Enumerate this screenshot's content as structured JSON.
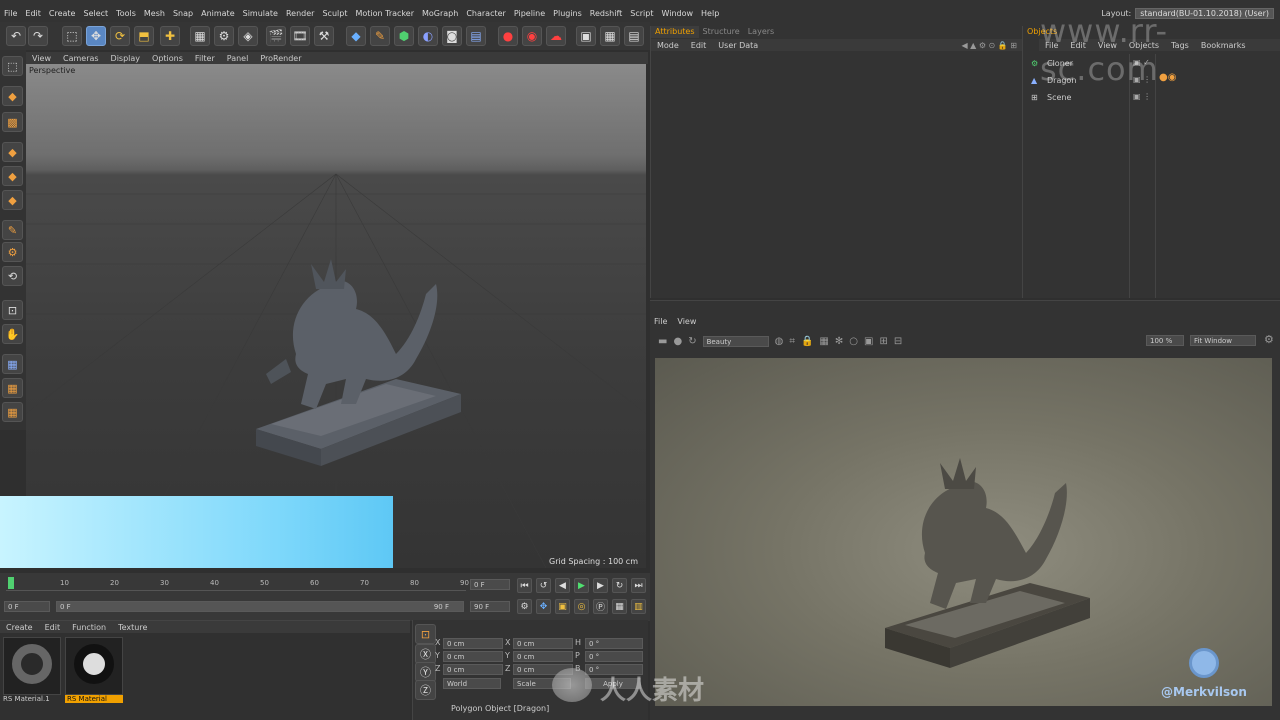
{
  "menu": [
    "File",
    "Edit",
    "Create",
    "Select",
    "Tools",
    "Mesh",
    "Snap",
    "Animate",
    "Simulate",
    "Render",
    "Sculpt",
    "Motion Tracker",
    "MoGraph",
    "Character",
    "Pipeline",
    "Plugins",
    "Redshift",
    "Script",
    "Window",
    "Help"
  ],
  "layout": {
    "label": "Layout:",
    "value": "standard(BU-01.10.2018) (User)"
  },
  "viewport": {
    "menu": [
      "View",
      "Cameras",
      "Display",
      "Options",
      "Filter",
      "Panel",
      "ProRender"
    ],
    "label": "Perspective",
    "grid_spacing": "Grid Spacing : 100 cm"
  },
  "timeline": {
    "ticks": [
      "0",
      "10",
      "20",
      "30",
      "40",
      "50",
      "60",
      "70",
      "80",
      "90"
    ],
    "current_frame": "0 F",
    "start": "0 F",
    "start2": "0 F",
    "end": "90 F",
    "end2": "90 F"
  },
  "materials": {
    "menu": [
      "Create",
      "Edit",
      "Function",
      "Texture"
    ],
    "items": [
      {
        "name": "RS Material.1",
        "selected": false
      },
      {
        "name": "RS Material",
        "selected": true
      }
    ]
  },
  "coords": {
    "rows": [
      {
        "axis": "X",
        "pos": "0 cm",
        "size": "0 cm",
        "rot_label": "H",
        "rot": "0 °"
      },
      {
        "axis": "Y",
        "pos": "0 cm",
        "size": "0 cm",
        "rot_label": "P",
        "rot": "0 °"
      },
      {
        "axis": "Z",
        "pos": "0 cm",
        "size": "0 cm",
        "rot_label": "B",
        "rot": "0 °"
      }
    ],
    "world": "World",
    "scale": "Scale",
    "apply": "Apply"
  },
  "attributes": {
    "tabs": [
      "Attributes",
      "Structure",
      "Layers"
    ],
    "menu": [
      "Mode",
      "Edit",
      "User Data"
    ]
  },
  "objects": {
    "tab": "Objects",
    "menu": [
      "File",
      "Edit",
      "View",
      "Objects",
      "Tags",
      "Bookmarks"
    ],
    "items": [
      "Cloner",
      "Dragon",
      "Scene"
    ]
  },
  "render": {
    "menu": [
      "File",
      "View"
    ],
    "pass": "Beauty",
    "zoom": "100 %",
    "fit": "Fit Window",
    "credit": "@Merkvilson"
  },
  "status": "Polygon Object [Dragon]",
  "watermark_top": "www.rr-sc.com",
  "watermark_bottom": "人人素材",
  "colors": {
    "accent": "#f0a000",
    "active_tool": "#5a87c3",
    "overlay": "#5ec8f5"
  }
}
